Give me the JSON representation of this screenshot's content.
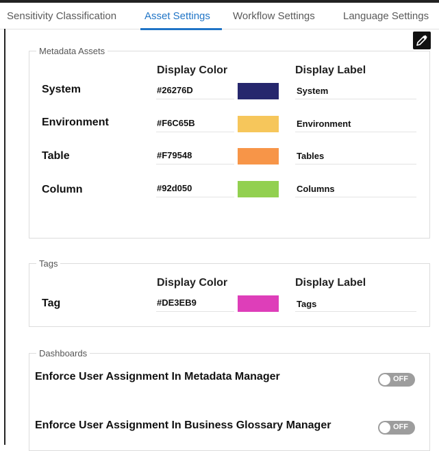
{
  "tabs": [
    {
      "label": "Sensitivity Classification"
    },
    {
      "label": "Asset Settings"
    },
    {
      "label": "Workflow Settings"
    },
    {
      "label": "Language Settings"
    }
  ],
  "active_tab": "Asset Settings",
  "edit_icon": "pencil-edit-icon",
  "metadata_assets": {
    "legend": "Metadata Assets",
    "col_color": "Display Color",
    "col_label": "Display Label",
    "rows": [
      {
        "name": "System",
        "hex": "#26276D",
        "color": "#26276D",
        "label": "System"
      },
      {
        "name": "Environment",
        "hex": "#F6C65B",
        "color": "#F6C65B",
        "label": "Environment"
      },
      {
        "name": "Table",
        "hex": "#F79548",
        "color": "#F79548",
        "label": "Tables"
      },
      {
        "name": "Column",
        "hex": "#92d050",
        "color": "#92d050",
        "label": "Columns"
      }
    ]
  },
  "tags": {
    "legend": "Tags",
    "col_color": "Display Color",
    "col_label": "Display Label",
    "rows": [
      {
        "name": "Tag",
        "hex": "#DE3EB9",
        "color": "#DE3EB9",
        "label": "Tags"
      }
    ]
  },
  "dashboards": {
    "legend": "Dashboards",
    "items": [
      {
        "label": "Enforce User Assignment In Metadata Manager",
        "state": "OFF"
      },
      {
        "label": "Enforce User Assignment In Business Glossary Manager",
        "state": "OFF"
      }
    ]
  },
  "colors": {
    "accent": "#1f74c6",
    "toggle_off": "#9d9d9d"
  }
}
